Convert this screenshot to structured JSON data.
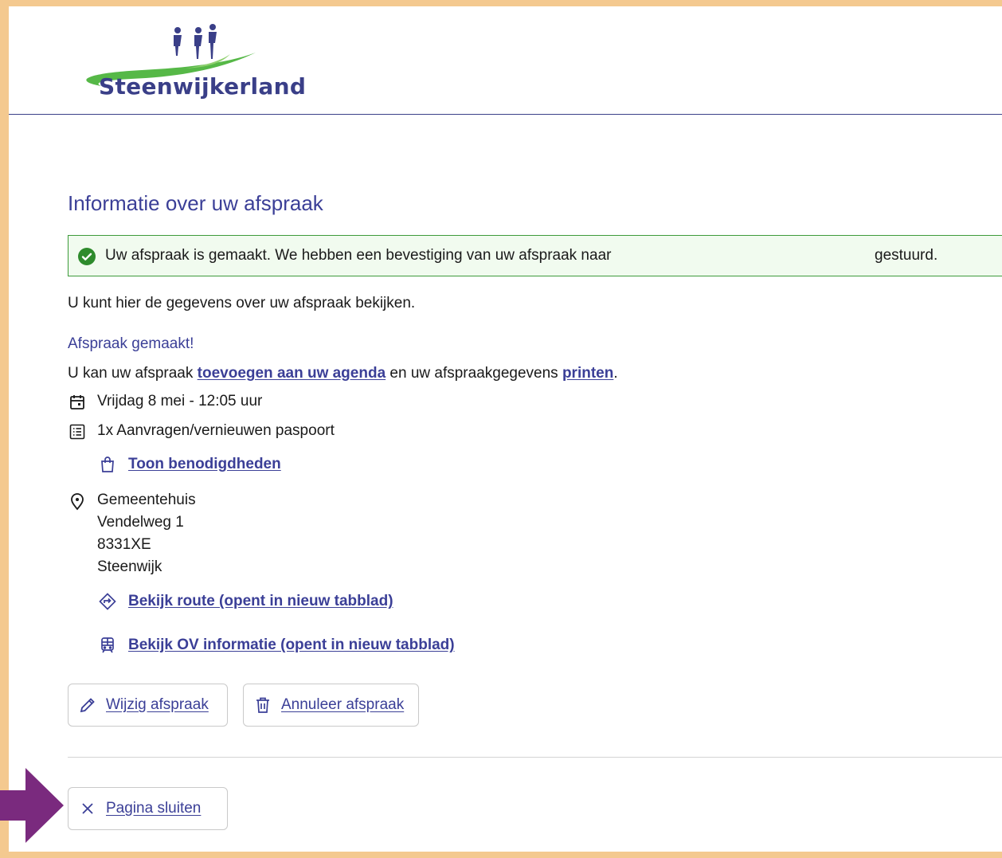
{
  "colors": {
    "brand_blue": "#3b3f97",
    "success_green": "#3d9a3a",
    "frame_orange": "#f4c98f",
    "arrow_purple": "#7a2a7e"
  },
  "header": {
    "logo_text": "Steenwijkerland"
  },
  "page": {
    "title": "Informatie over uw afspraak",
    "success_message": "Uw afspraak is gemaakt. We hebben een bevestiging van uw afspraak naar",
    "success_suffix": "gestuurd.",
    "intro": "U kunt hier de gegevens over uw afspraak bekijken.",
    "subheading": "Afspraak gemaakt!",
    "sentence": {
      "part1": "U kan uw afspraak ",
      "link_calendar": "toevoegen aan uw agenda",
      "part2": " en uw afspraakgegevens ",
      "link_print": "printen",
      "part3": "."
    }
  },
  "appointment": {
    "datetime": "Vrijdag 8 mei - 12:05 uur",
    "service": "1x Aanvragen/vernieuwen paspoort",
    "requirements_link": "Toon benodigdheden",
    "location": {
      "name": "Gemeentehuis",
      "street": "Vendelweg 1",
      "postcode": "8331XE",
      "city": "Steenwijk"
    },
    "route_link": "Bekijk route (opent in nieuw tabblad)",
    "ov_link": "Bekijk OV informatie (opent in nieuw tabblad)"
  },
  "actions": {
    "edit": "Wijzig afspraak",
    "cancel": "Annuleer afspraak",
    "close": "Pagina sluiten"
  },
  "icons": {
    "success": "check-circle-icon",
    "calendar": "calendar-icon",
    "list": "list-icon",
    "bag": "shopping-bag-icon",
    "location": "map-pin-icon",
    "route": "route-diamond-icon",
    "ov": "train-icon",
    "edit": "pencil-icon",
    "cancel": "trash-icon",
    "close": "close-icon",
    "annotation": "arrow-right-icon"
  }
}
